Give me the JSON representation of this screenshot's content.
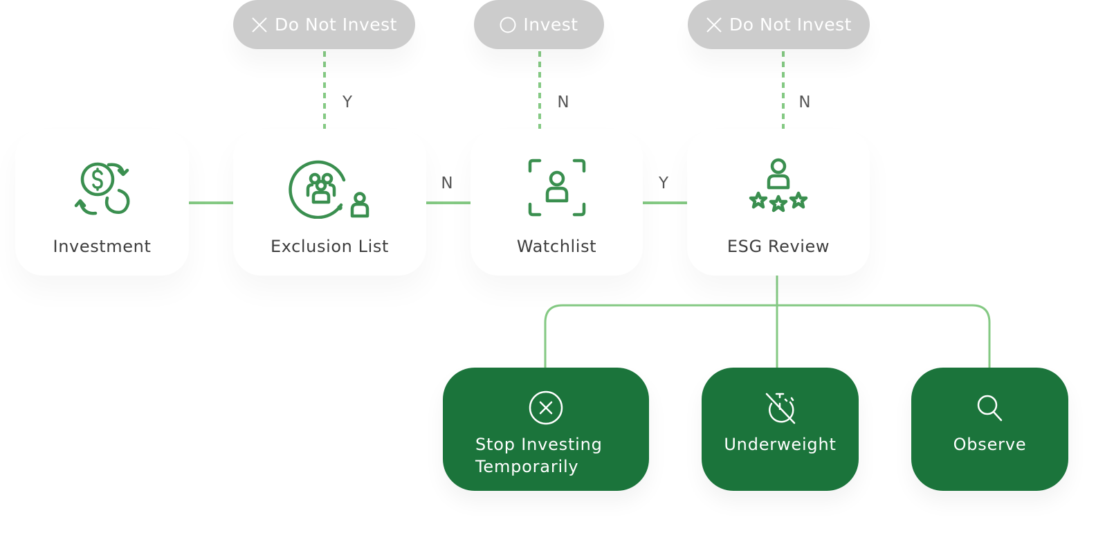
{
  "colors": {
    "icon_green": "#3a8f4f",
    "connector_green": "#84c983",
    "action_green": "#1b743b",
    "outcome_gray": "#cccccc",
    "text_dark": "#3d3d3d"
  },
  "outcomes": [
    {
      "icon": "x-icon",
      "label": "Do Not Invest"
    },
    {
      "icon": "circle-icon",
      "label": "Invest"
    },
    {
      "icon": "x-icon",
      "label": "Do Not Invest"
    }
  ],
  "vertical_edge_labels": [
    "Y",
    "N",
    "N"
  ],
  "horizontal_edge_labels": [
    "N",
    "Y"
  ],
  "nodes": [
    {
      "icon": "money-cycle-icon",
      "label": "Investment"
    },
    {
      "icon": "group-exclusion-icon",
      "label": "Exclusion List"
    },
    {
      "icon": "user-focus-icon",
      "label": "Watchlist"
    },
    {
      "icon": "user-rating-icon",
      "label": "ESG Review"
    }
  ],
  "actions": [
    {
      "icon": "x-circle-icon",
      "label": "Stop Investing Temporarily",
      "line1": "Stop Investing",
      "line2": "Temporarily"
    },
    {
      "icon": "stopwatch-off-icon",
      "label": "Underweight"
    },
    {
      "icon": "search-icon",
      "label": "Observe"
    }
  ]
}
